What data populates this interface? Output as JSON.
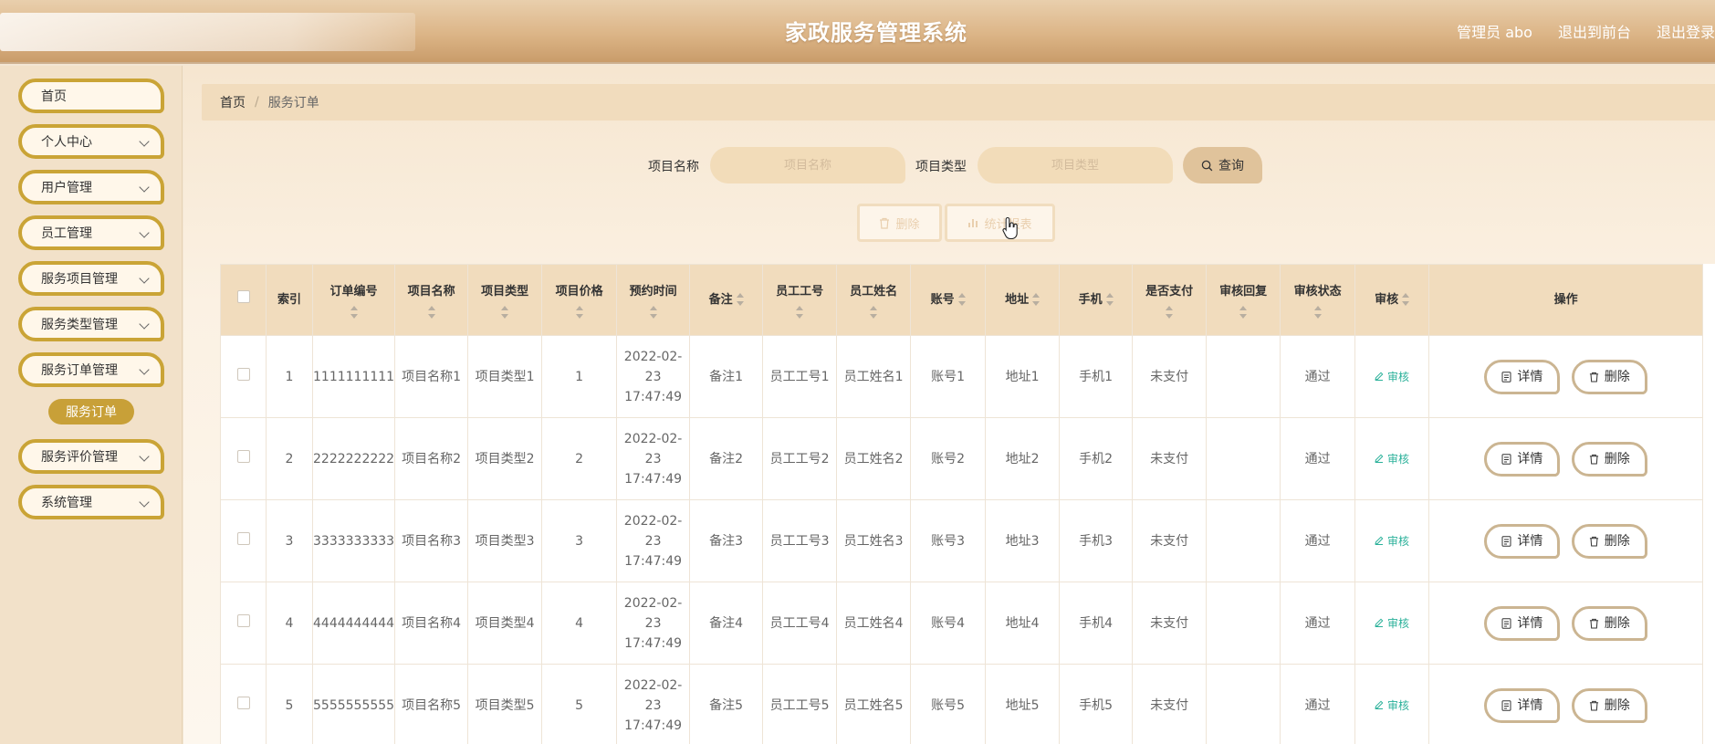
{
  "header": {
    "title": "家政服务管理系统",
    "user": "管理员 abo",
    "to_frontend": "退出到前台",
    "logout": "退出登录"
  },
  "sidebar": {
    "items": [
      {
        "label": "首页",
        "has_children": false
      },
      {
        "label": "个人中心",
        "has_children": true
      },
      {
        "label": "用户管理",
        "has_children": true
      },
      {
        "label": "员工管理",
        "has_children": true
      },
      {
        "label": "服务项目管理",
        "has_children": true
      },
      {
        "label": "服务类型管理",
        "has_children": true
      },
      {
        "label": "服务订单管理",
        "has_children": true
      },
      {
        "label": "服务评价管理",
        "has_children": true
      },
      {
        "label": "系统管理",
        "has_children": true
      }
    ],
    "active_sub": "服务订单"
  },
  "breadcrumb": {
    "home": "首页",
    "sep": "/",
    "current": "服务订单"
  },
  "search": {
    "name_label": "项目名称",
    "name_placeholder": "项目名称",
    "type_label": "项目类型",
    "type_placeholder": "项目类型",
    "query_label": "查询"
  },
  "actions": {
    "delete_label": "删除",
    "stats_label": "统计报表"
  },
  "table": {
    "headers": [
      "索引",
      "订单编号",
      "项目名称",
      "项目类型",
      "项目价格",
      "预约时间",
      "备注",
      "员工工号",
      "员工姓名",
      "账号",
      "地址",
      "手机",
      "是否支付",
      "审核回复",
      "审核状态",
      "审核",
      "操作"
    ],
    "rows": [
      [
        "1",
        "1111111111",
        "项目名称1",
        "项目类型1",
        "1",
        "2022-02-23 17:47:49",
        "备注1",
        "员工工号1",
        "员工姓名1",
        "账号1",
        "地址1",
        "手机1",
        "未支付",
        "",
        "通过"
      ],
      [
        "2",
        "2222222222",
        "项目名称2",
        "项目类型2",
        "2",
        "2022-02-23 17:47:49",
        "备注2",
        "员工工号2",
        "员工姓名2",
        "账号2",
        "地址2",
        "手机2",
        "未支付",
        "",
        "通过"
      ],
      [
        "3",
        "3333333333",
        "项目名称3",
        "项目类型3",
        "3",
        "2022-02-23 17:47:49",
        "备注3",
        "员工工号3",
        "员工姓名3",
        "账号3",
        "地址3",
        "手机3",
        "未支付",
        "",
        "通过"
      ],
      [
        "4",
        "4444444444",
        "项目名称4",
        "项目类型4",
        "4",
        "2022-02-23 17:47:49",
        "备注4",
        "员工工号4",
        "员工姓名4",
        "账号4",
        "地址4",
        "手机4",
        "未支付",
        "",
        "通过"
      ],
      [
        "5",
        "5555555555",
        "项目名称5",
        "项目类型5",
        "5",
        "2022-02-23 17:47:49",
        "备注5",
        "员工工号5",
        "员工姓名5",
        "账号5",
        "地址5",
        "手机5",
        "未支付",
        "",
        "通过"
      ]
    ],
    "audit_label": "审核",
    "detail_label": "详情",
    "delete_label": "删除"
  },
  "colors": {
    "accent": "#c8a038",
    "header_bg": "#f1dcbd",
    "audit": "#2bb19a"
  }
}
